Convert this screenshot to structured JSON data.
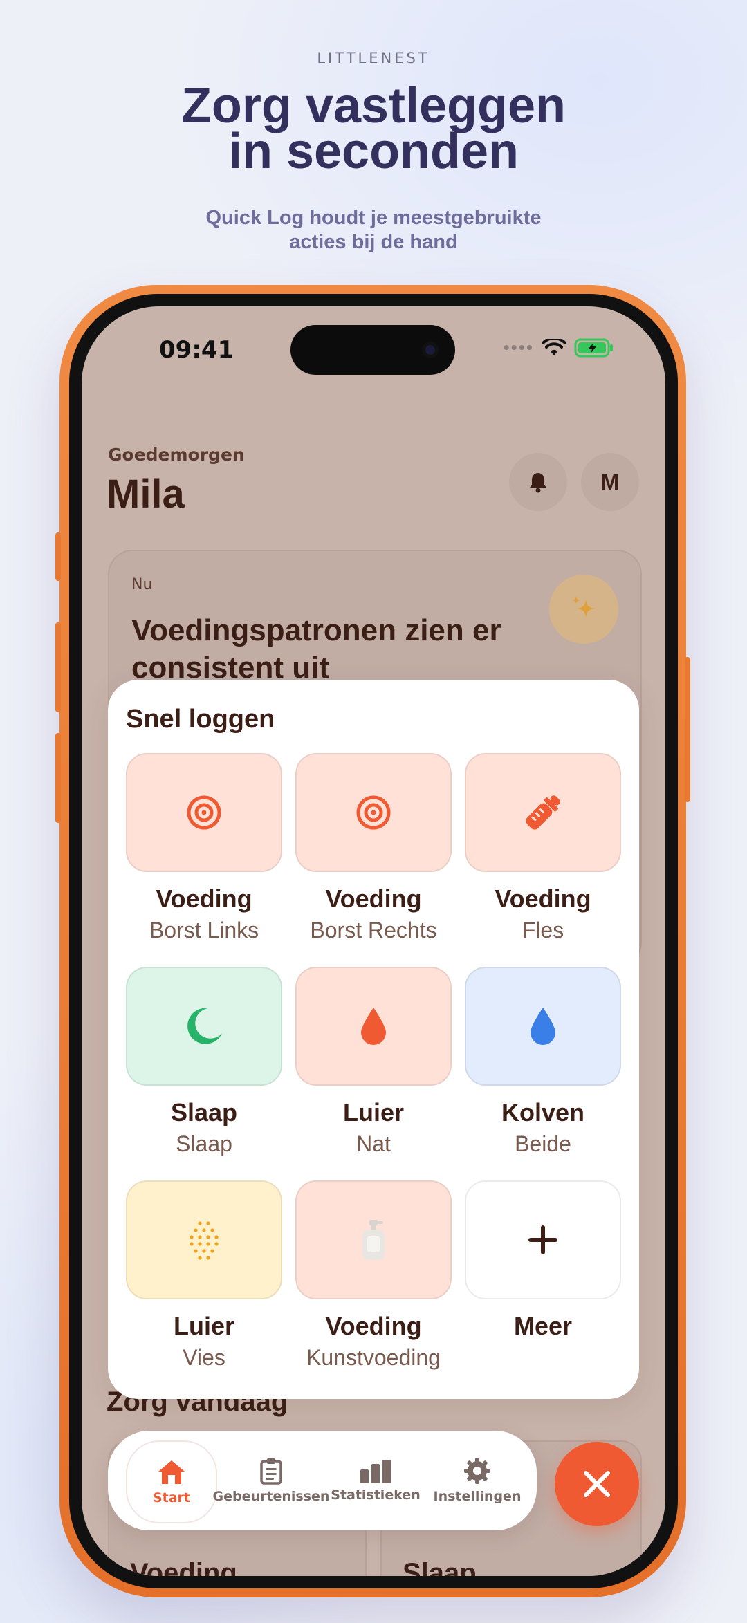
{
  "marketing": {
    "brand": "LITTLENEST",
    "headline_line1": "Zorg vastleggen",
    "headline_line2": "in seconden",
    "subline_line1": "Quick Log houdt je meestgebruikte",
    "subline_line2": "acties bij de hand"
  },
  "status_bar": {
    "time": "09:41",
    "battery_color": "#34c759"
  },
  "header": {
    "greeting": "Goedemorgen",
    "name": "Mila",
    "avatar_initial": "M"
  },
  "now_card": {
    "label": "Nu",
    "title": "Voedingspatronen zien er consistent uit"
  },
  "background_sections": {
    "heading": "Zorg vandaag",
    "cards": [
      "Voeding",
      "Slaap"
    ]
  },
  "quick_log": {
    "title": "Snel loggen",
    "tiles": [
      {
        "title": "Voeding",
        "subtitle": "Borst Links",
        "icon": "breast-left-icon",
        "color": "#ef5a32"
      },
      {
        "title": "Voeding",
        "subtitle": "Borst Rechts",
        "icon": "breast-right-icon",
        "color": "#ef5a32"
      },
      {
        "title": "Voeding",
        "subtitle": "Fles",
        "icon": "bottle-icon",
        "color": "#ef5a32"
      },
      {
        "title": "Slaap",
        "subtitle": "Slaap",
        "icon": "moon-icon",
        "color": "#27b36a"
      },
      {
        "title": "Luier",
        "subtitle": "Nat",
        "icon": "drop-icon",
        "color": "#ef5a32"
      },
      {
        "title": "Kolven",
        "subtitle": "Beide",
        "icon": "drop-icon",
        "color": "#3a7ee8"
      },
      {
        "title": "Luier",
        "subtitle": "Vies",
        "icon": "dots-icon",
        "color": "#f0a21c"
      },
      {
        "title": "Voeding",
        "subtitle": "Kunstvoeding",
        "icon": "formula-icon",
        "color": "#d9d4cf"
      },
      {
        "title": "Meer",
        "subtitle": "",
        "icon": "plus-icon",
        "color": "#3b1f17"
      }
    ]
  },
  "tabbar": {
    "tabs": [
      {
        "label": "Start",
        "icon": "home-icon"
      },
      {
        "label": "Gebeurtenissen",
        "icon": "clipboard-icon"
      },
      {
        "label": "Statistieken",
        "icon": "bar-chart-icon"
      },
      {
        "label": "Instellingen",
        "icon": "gear-icon"
      }
    ],
    "active_color": "#ef5a32"
  }
}
